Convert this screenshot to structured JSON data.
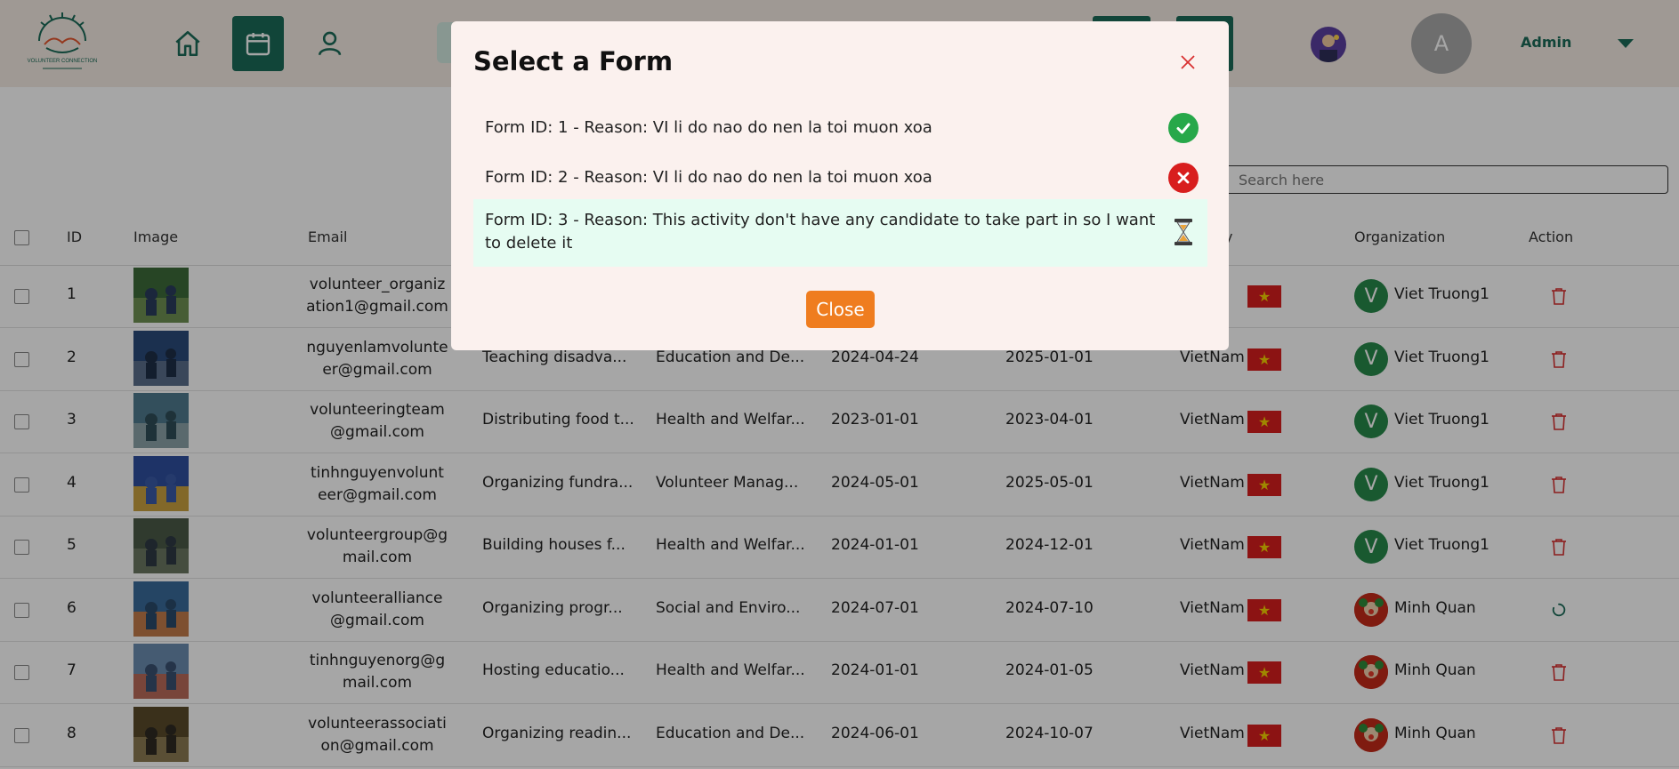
{
  "header": {
    "logo_text": "VOLUNTEER CONNECTION",
    "admin_initial": "A",
    "admin_label": "Admin"
  },
  "search": {
    "placeholder": "Search here"
  },
  "table": {
    "columns": [
      "ID",
      "Image",
      "Email",
      "Organization",
      "Action"
    ],
    "partial_column": "y",
    "rows": [
      {
        "id": "1",
        "email": "volunteer_organization1@gmail.com",
        "description": "",
        "category": "",
        "start": "",
        "end": "",
        "country": "m",
        "org_initial": "V",
        "org": "Viet Truong1",
        "action": "trash"
      },
      {
        "id": "2",
        "email": "nguyenlamvolunteer@gmail.com",
        "description": "Teaching disadva...",
        "category": "Education and De...",
        "start": "2024-04-24",
        "end": "2025-01-01",
        "country": "VietNam",
        "org_initial": "V",
        "org": "Viet Truong1",
        "action": "trash"
      },
      {
        "id": "3",
        "email": "volunteeringteam@gmail.com",
        "description": "Distributing food t...",
        "category": "Health and Welfar...",
        "start": "2023-01-01",
        "end": "2023-04-01",
        "country": "VietNam",
        "org_initial": "V",
        "org": "Viet Truong1",
        "action": "trash"
      },
      {
        "id": "4",
        "email": "tinhnguyenvolunteer@gmail.com",
        "description": "Organizing fundra...",
        "category": "Volunteer Manag...",
        "start": "2024-05-01",
        "end": "2025-05-01",
        "country": "VietNam",
        "org_initial": "V",
        "org": "Viet Truong1",
        "action": "trash"
      },
      {
        "id": "5",
        "email": "volunteergroup@gmail.com",
        "description": "Building houses f...",
        "category": "Health and Welfar...",
        "start": "2024-01-01",
        "end": "2024-12-01",
        "country": "VietNam",
        "org_initial": "V",
        "org": "Viet Truong1",
        "action": "trash"
      },
      {
        "id": "6",
        "email": "volunteeralliance@gmail.com",
        "description": "Organizing progr...",
        "category": "Social and Enviro...",
        "start": "2024-07-01",
        "end": "2024-07-10",
        "country": "VietNam",
        "org_initial": "",
        "org": "Minh Quan",
        "action": "loading"
      },
      {
        "id": "7",
        "email": "tinhnguyenorg@gmail.com",
        "description": "Hosting educatio...",
        "category": "Health and Welfar...",
        "start": "2024-01-01",
        "end": "2024-01-05",
        "country": "VietNam",
        "org_initial": "",
        "org": "Minh Quan",
        "action": "trash"
      },
      {
        "id": "8",
        "email": "volunteerassociation@gmail.com",
        "description": "Organizing readin...",
        "category": "Education and De...",
        "start": "2024-06-01",
        "end": "2024-10-07",
        "country": "VietNam",
        "org_initial": "",
        "org": "Minh Quan",
        "action": "trash"
      }
    ]
  },
  "modal": {
    "title": "Select a Form",
    "forms": [
      {
        "text": "Form ID: 1 - Reason: VI li do nao do nen la toi muon xoa",
        "status": "approved"
      },
      {
        "text": "Form ID: 2 - Reason: VI li do nao do nen la toi muon xoa",
        "status": "rejected"
      },
      {
        "text": "Form ID: 3 - Reason: This activity don't have any candidate to take part in so I want to delete it",
        "status": "pending"
      }
    ],
    "close_label": "Close"
  },
  "colors": {
    "primary": "#1b6b58",
    "accent": "#ef7d1f",
    "danger": "#d81e1e",
    "approved": "#27a84a",
    "modal_bg": "#fbf1ee",
    "highlight": "#e6fcf2"
  }
}
